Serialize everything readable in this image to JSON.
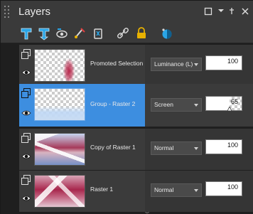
{
  "window": {
    "title": "Layers",
    "buttons": [
      "maximize",
      "menu",
      "pin",
      "close"
    ]
  },
  "toolbar": {
    "tools": [
      {
        "name": "new-raster-layer-icon",
        "color": "#2aa5e6"
      },
      {
        "name": "new-vector-layer-icon",
        "color": "#2aa5e6"
      },
      {
        "name": "new-layer-group-icon",
        "color": "#d9d9d9"
      },
      {
        "name": "new-mask-layer-icon",
        "color": "#d9d9d9"
      },
      {
        "name": "delete-layer-icon",
        "color": "#d9d9d9"
      },
      {
        "name": "link-icon",
        "color": "#d9d9d9"
      },
      {
        "name": "lock-icon",
        "color": "#e8b100"
      },
      {
        "name": "adjustment-layer-icon",
        "color": "#2aa5e6"
      }
    ]
  },
  "layers": [
    {
      "name": "Promoted Selection",
      "blend_mode": "Luminance (L)",
      "opacity": "100",
      "opacity_fraction": 1.0,
      "selected": false
    },
    {
      "name": "Group - Raster 2",
      "blend_mode": "Screen",
      "opacity": "65",
      "opacity_fraction": 0.65,
      "selected": true
    },
    {
      "name": "Copy of Raster 1",
      "blend_mode": "Normal",
      "opacity": "100",
      "opacity_fraction": 1.0,
      "selected": false
    },
    {
      "name": "Raster 1",
      "blend_mode": "Normal",
      "opacity": "100",
      "opacity_fraction": 1.0,
      "selected": false
    }
  ],
  "colors": {
    "selection": "#3d8ee0",
    "row_bg": "#3b3b3b"
  }
}
